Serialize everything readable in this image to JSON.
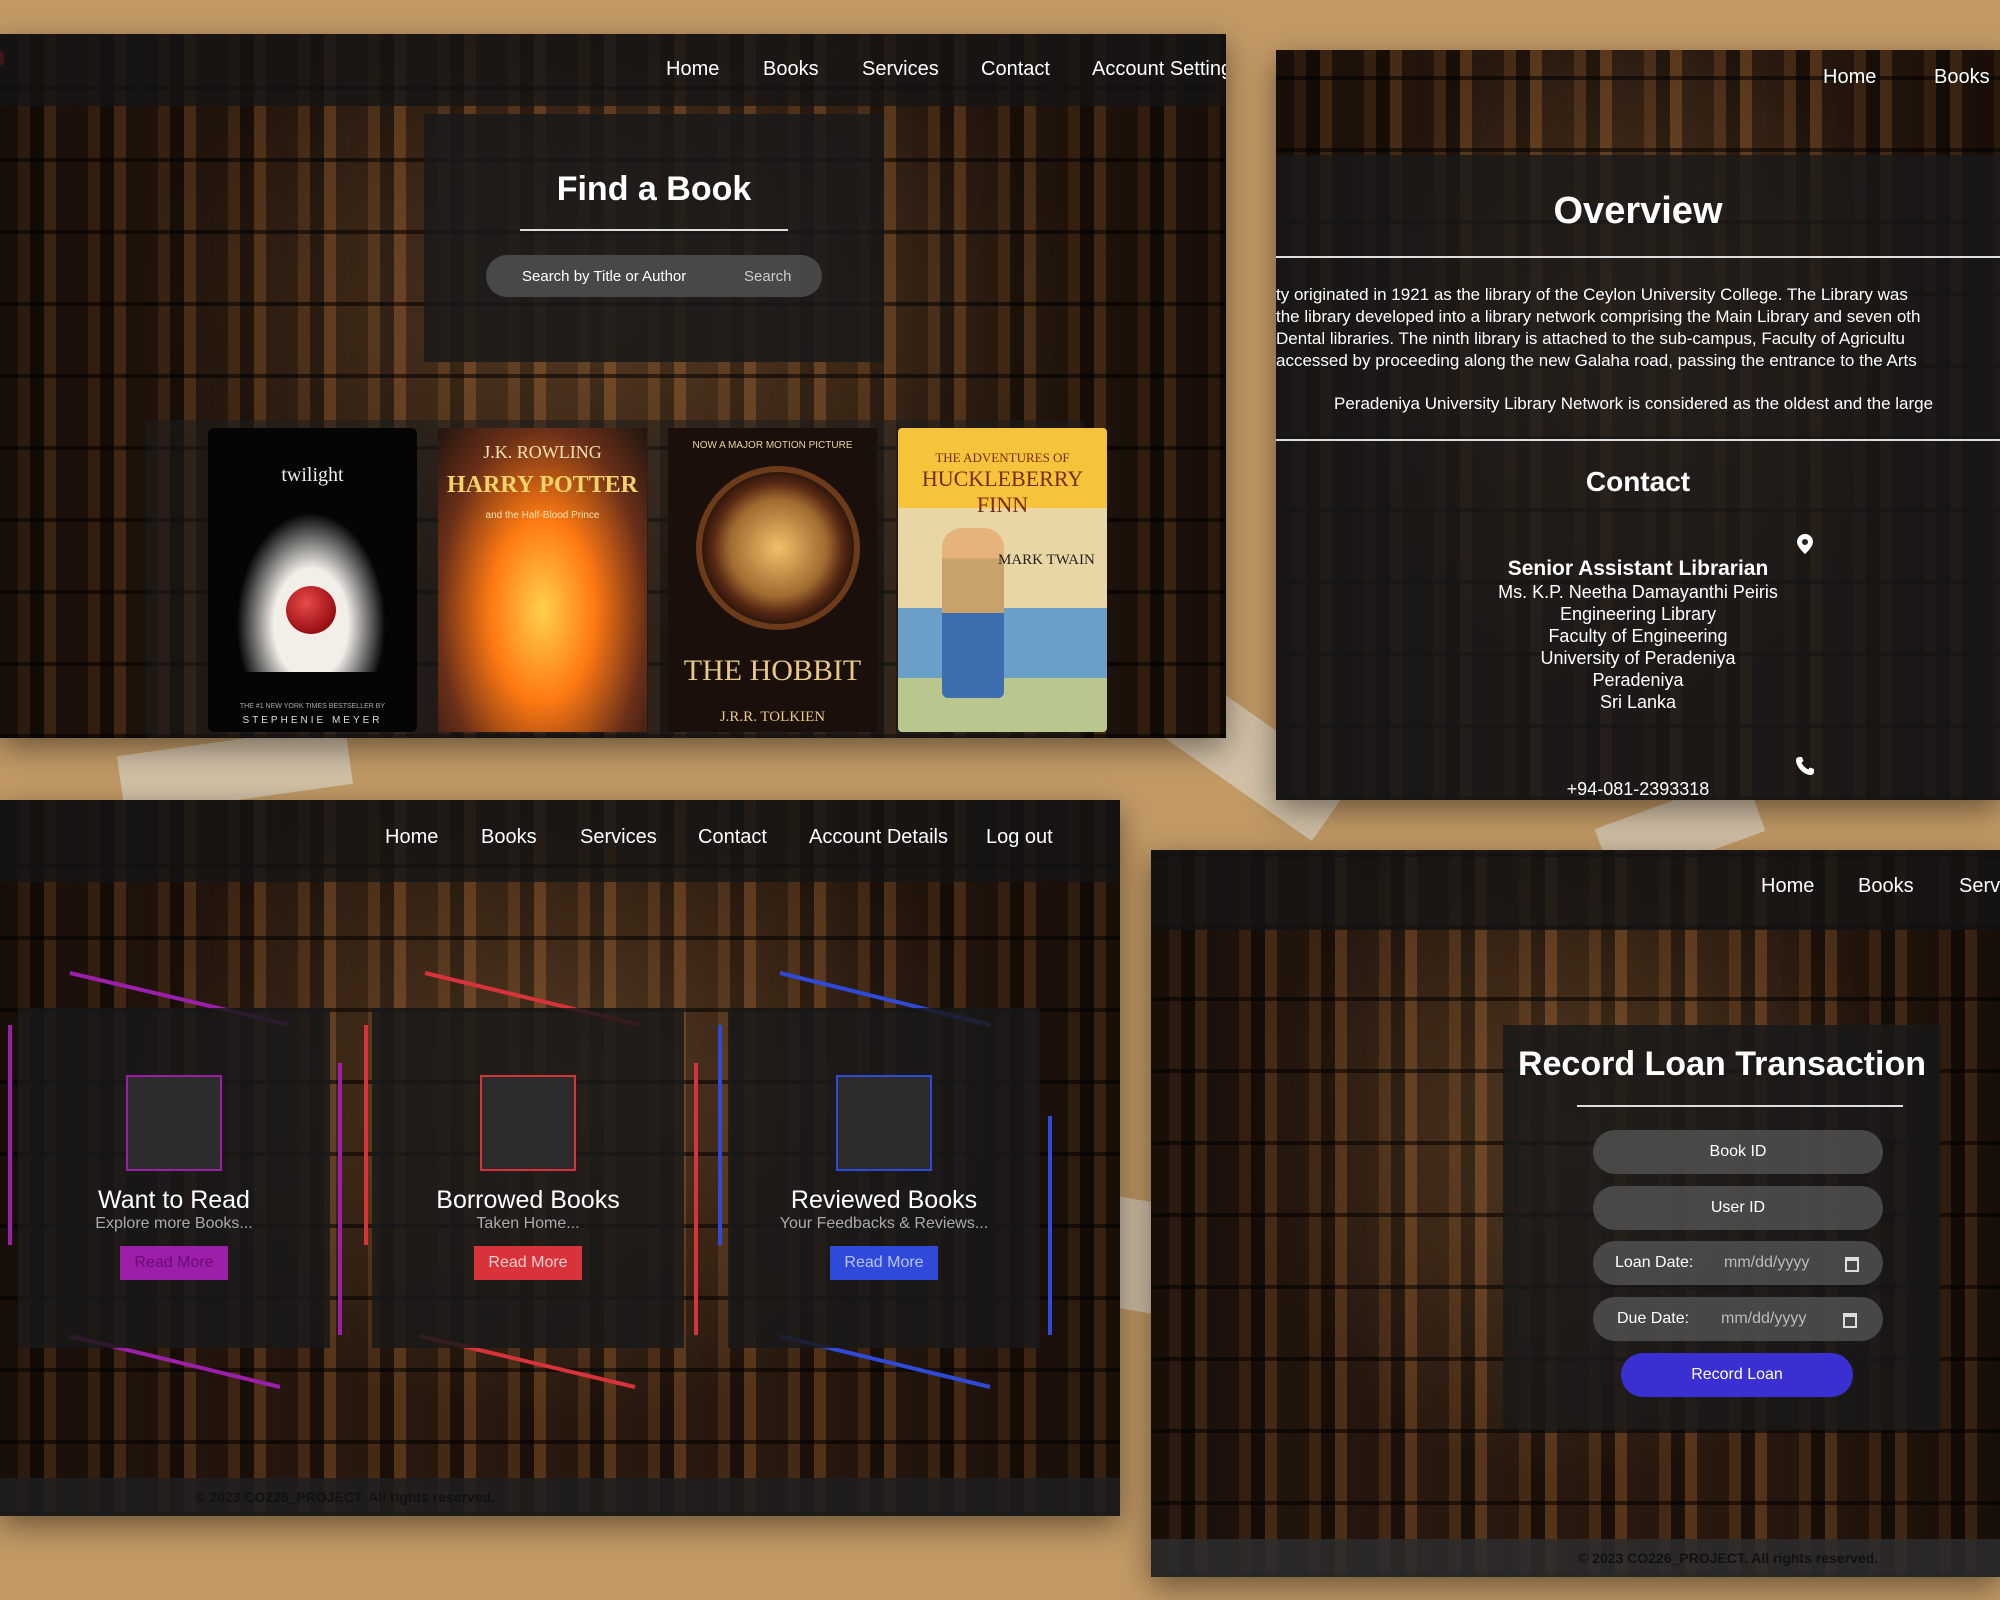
{
  "find_page": {
    "nav": [
      "Home",
      "Books",
      "Services",
      "Contact",
      "Account Setting"
    ],
    "title": "Find a Book",
    "search_placeholder": "Search by Title or Author",
    "search_button": "Search",
    "books": [
      {
        "title": "twilight",
        "author": "STEPHENIE MEYER",
        "banner": "THE #1 NEW YORK TIMES BESTSELLER BY"
      },
      {
        "title": "HARRY POTTER",
        "author": "J.K. ROWLING",
        "subtitle": "and the Half-Blood Prince"
      },
      {
        "title": "THE HOBBIT",
        "author": "J.R.R. TOLKIEN",
        "banner": "NOW A MAJOR MOTION PICTURE"
      },
      {
        "title": "HUCKLEBERRY FINN",
        "pretitle": "THE ADVENTURES OF",
        "author": "MARK TWAIN"
      }
    ]
  },
  "overview_page": {
    "nav": [
      "Home",
      "Books"
    ],
    "title": "Overview",
    "paragraph_lines": [
      "ty originated in 1921 as the library of the Ceylon University College. The Library was",
      "the library developed into a library network comprising the Main Library and seven oth",
      "Dental libraries. The ninth library is attached to the sub-campus, Faculty of Agricultu",
      "accessed by proceeding along the new Galaha road, passing the entrance to the Arts"
    ],
    "paragraph2": "Peradeniya University Library Network is considered as the oldest and the large",
    "contact_title": "Contact",
    "contact_role": "Senior Assistant Librarian",
    "contact_lines": [
      "Ms. K.P. Neetha Damayanthi Peiris",
      "Engineering Library",
      "Faculty of Engineering",
      "University of Peradeniya",
      "Peradeniya",
      "Sri Lanka"
    ],
    "phone": "+94-081-2393318"
  },
  "dashboard_page": {
    "nav": [
      "Home",
      "Books",
      "Services",
      "Contact",
      "Account Details",
      "Log out"
    ],
    "cards": [
      {
        "title": "Want to Read",
        "subtitle": "Explore more Books...",
        "button": "Read More",
        "color": "#9b1fa8"
      },
      {
        "title": "Borrowed Books",
        "subtitle": "Taken Home...",
        "button": "Read More",
        "color": "#d8323b"
      },
      {
        "title": "Reviewed Books",
        "subtitle": "Your Feedbacks & Reviews...",
        "button": "Read More",
        "color": "#2f49d8"
      }
    ],
    "footer": "© 2023 CO226_PROJECT. All rights reserved."
  },
  "loan_page": {
    "nav": [
      "Home",
      "Books",
      "Servi"
    ],
    "title": "Record Loan Transaction",
    "book_id_placeholder": "Book ID",
    "user_id_placeholder": "User ID",
    "loan_date_label": "Loan Date:",
    "due_date_label": "Due Date:",
    "date_placeholder": "mm/dd/yyyy",
    "submit": "Record Loan",
    "footer": "© 2023 CO226_PROJECT. All rights reserved."
  },
  "colors": {
    "canvas": "#c39a66",
    "accent_blue": "#3a2fd0"
  }
}
